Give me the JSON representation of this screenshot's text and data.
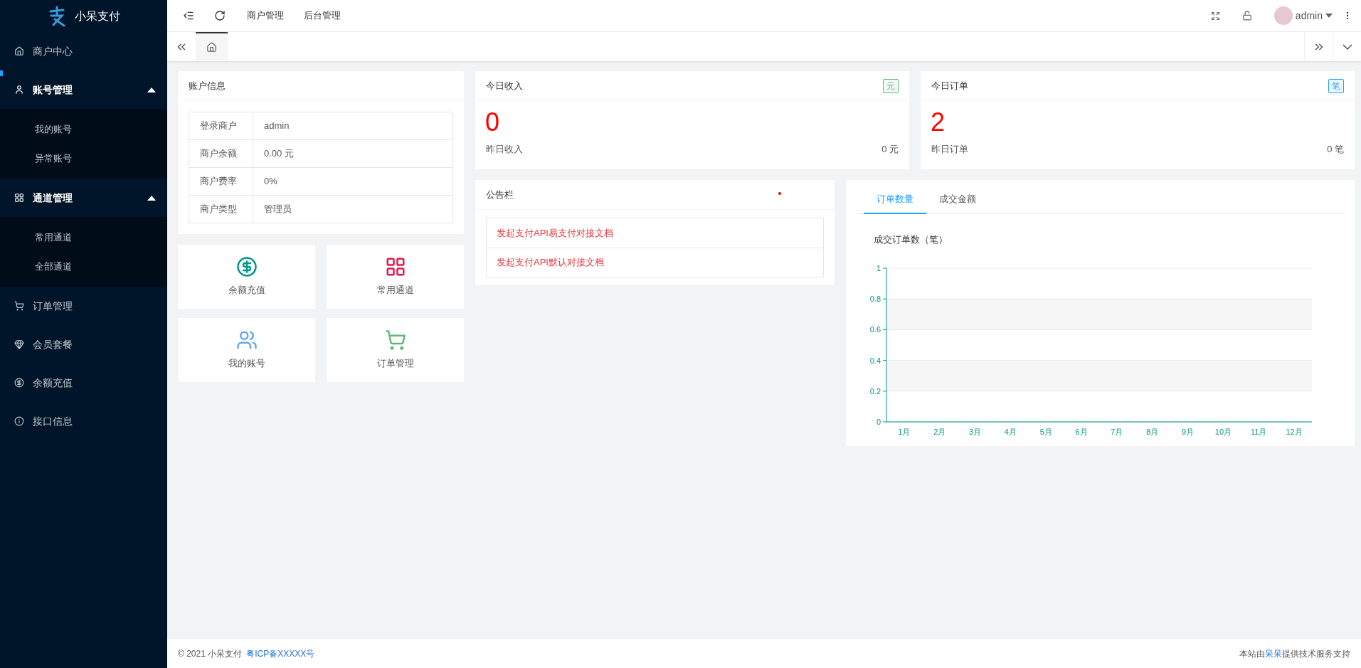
{
  "brand": {
    "name": "小呆支付"
  },
  "sidebar": {
    "items": [
      {
        "label": "商户中心"
      },
      {
        "label": "账号管理",
        "expanded": true,
        "children": [
          {
            "label": "我的账号"
          },
          {
            "label": "异常账号"
          }
        ]
      },
      {
        "label": "通道管理",
        "expanded": true,
        "children": [
          {
            "label": "常用通道"
          },
          {
            "label": "全部通道"
          }
        ]
      },
      {
        "label": "订单管理"
      },
      {
        "label": "会员套餐"
      },
      {
        "label": "余额充值"
      },
      {
        "label": "接口信息"
      }
    ]
  },
  "topbar": {
    "menus": [
      "商户管理",
      "后台管理"
    ],
    "user": "admin"
  },
  "account": {
    "title": "账户信息",
    "rows": [
      {
        "label": "登录商户",
        "value": "admin"
      },
      {
        "label": "商户余额",
        "value": "0.00 元"
      },
      {
        "label": "商户费率",
        "value": "0%"
      },
      {
        "label": "商户类型",
        "value": "管理员"
      }
    ]
  },
  "shortcuts": [
    {
      "label": "余额充值"
    },
    {
      "label": "常用通道"
    },
    {
      "label": "我的账号"
    },
    {
      "label": "订单管理"
    }
  ],
  "stats": [
    {
      "title": "今日收入",
      "badge": "元",
      "color": "#5fb878",
      "value": "0",
      "sub_label": "昨日收入",
      "sub_value": "0 元"
    },
    {
      "title": "今日订单",
      "badge": "笔",
      "color": "#1e9fff",
      "value": "2",
      "sub_label": "昨日订单",
      "sub_value": "0 笔"
    }
  ],
  "notice": {
    "title": "公告栏",
    "links": [
      "发起支付API易支付对接文档",
      "发起支付API默认对接文档"
    ]
  },
  "chart_panel": {
    "tabs": [
      {
        "label": "订单数量",
        "selected": true
      },
      {
        "label": "成交金额",
        "selected": false
      }
    ],
    "chart_data": {
      "type": "bar",
      "grid": true,
      "title": "成交订单数（笔）",
      "categories": [
        "1月",
        "2月",
        "3月",
        "4月",
        "5月",
        "6月",
        "7月",
        "8月",
        "9月",
        "10月",
        "11月",
        "12月"
      ],
      "values": [
        0,
        0,
        0,
        0,
        0,
        0,
        0,
        0,
        0,
        0,
        0,
        0
      ],
      "ylim": [
        0,
        1
      ],
      "yticks": [
        0,
        {
          "value": 0.2,
          "label": "0.2"
        },
        {
          "value": 0.4,
          "label": "0.4"
        },
        {
          "value": 0.6,
          "label": "0.6"
        },
        {
          "value": 0.8,
          "label": "0.8"
        },
        1
      ]
    }
  },
  "footer": {
    "copyright": "© 2021 小呆支付",
    "icp": "粤ICP备XXXXX号",
    "credit_before": "本站由",
    "credit_link": "呆呆",
    "credit_after": "提供技术服务支持"
  }
}
